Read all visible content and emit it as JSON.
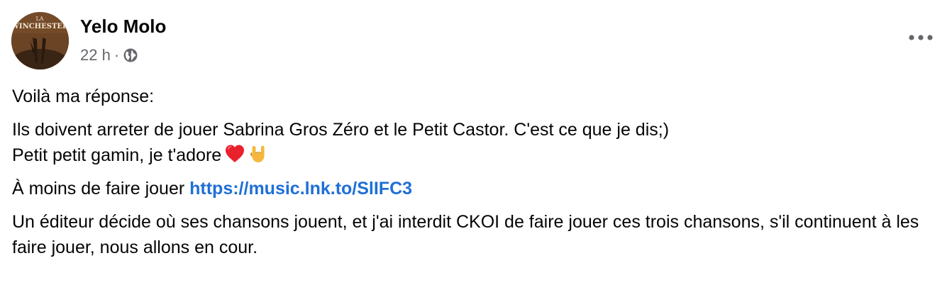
{
  "post": {
    "author": "Yelo Molo",
    "avatar_text": "LA WINCHESTER",
    "time": "22 h",
    "separator": "·",
    "privacy_icon": "globe-icon",
    "more_icon": "more-horizontal-icon",
    "lines": {
      "intro": "Voilà ma réponse:",
      "line2": "Ils doivent arreter de jouer Sabrina Gros Zéro et le Petit Castor.  C'est ce que je dis;)",
      "line3": "Petit petit gamin, je t'adore",
      "line3_emojis": [
        "heart-emoji",
        "rock-hand-emoji"
      ],
      "line4_prefix": "À moins de faire jouer ",
      "line4_link": "https://music.lnk.to/SlIFC3",
      "line5": "Un éditeur décide où ses chansons jouent, et j'ai interdit CKOI de faire jouer ces trois chansons, s'il continuent à les faire jouer, nous allons en cour."
    },
    "colors": {
      "text": "#050505",
      "secondary": "#65676b",
      "link": "#1f6fd6"
    }
  }
}
